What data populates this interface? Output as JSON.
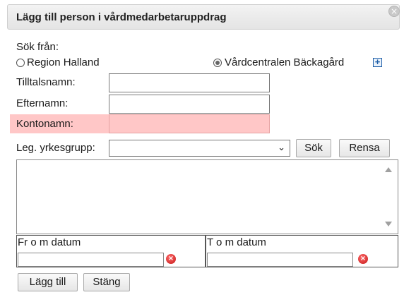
{
  "dialog": {
    "title": "Lägg till person i vårdmedarbetaruppdrag",
    "close_glyph": "×"
  },
  "search": {
    "from_label": "Sök från:",
    "options": [
      {
        "label": "Region Halland",
        "selected": false
      },
      {
        "label": "Vårdcentralen Bäckagård",
        "selected": true
      }
    ],
    "plus_glyph": "+"
  },
  "fields": {
    "tilltalsnamn_label": "Tilltalsnamn:",
    "tilltalsnamn_value": "",
    "efternamn_label": "Efternamn:",
    "efternamn_value": "",
    "kontonamn_label": "Kontonamn:",
    "kontonamn_value": "",
    "yrkesgrupp_label": "Leg. yrkesgrupp:",
    "yrkesgrupp_value": ""
  },
  "buttons": {
    "search": "Sök",
    "clear": "Rensa",
    "add": "Lägg till",
    "close": "Stäng"
  },
  "dates": {
    "from_label": "Fr o m datum",
    "from_value": "",
    "to_label": "T o m datum",
    "to_value": "",
    "clear_glyph": "×"
  },
  "icons": {
    "dropdown": "chevron-down-icon",
    "close": "close-icon",
    "clear_date": "clear-icon",
    "expand": "plus-icon"
  },
  "colors": {
    "required_highlight": "#ffc7c7",
    "clear_icon": "#d62020"
  }
}
